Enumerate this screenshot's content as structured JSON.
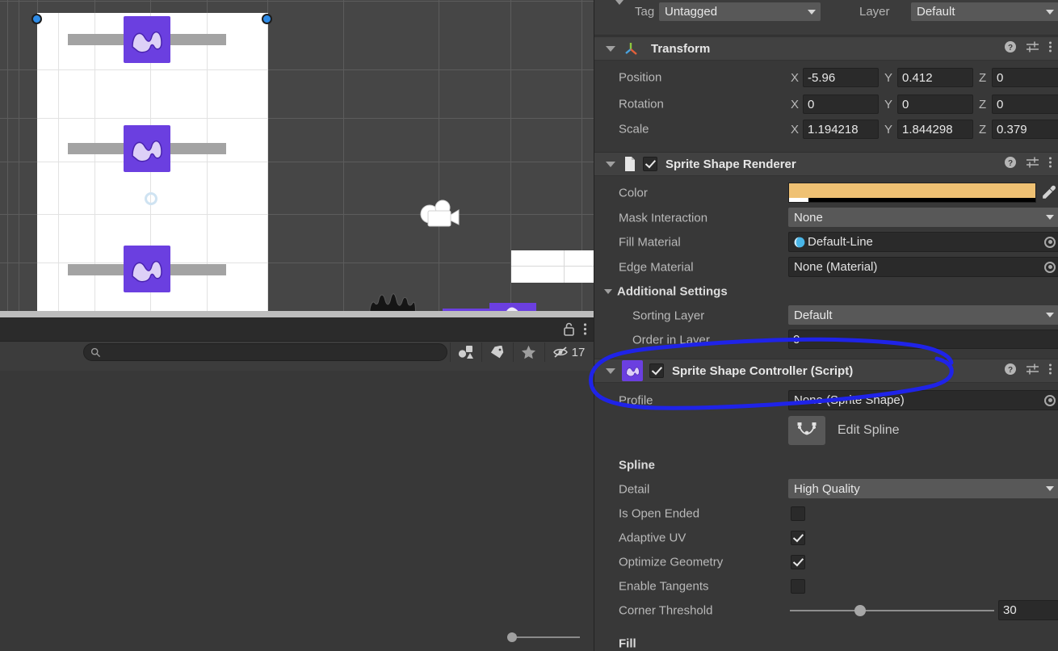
{
  "app": "unity-editor",
  "scene": {
    "name": "scene-view",
    "sprite_shape_label": "sprite-shape-selection",
    "gizmos": [
      "camera-gizmo",
      "spline-handle",
      "pivot-ring"
    ]
  },
  "hierarchy_toolbar": {
    "search_placeholder": "",
    "search_value": "",
    "icons": [
      "lock-icon",
      "kebab-menu-icon",
      "search-icon",
      "sprite-filter-icon",
      "tag-filter-icon",
      "favorite-star-icon",
      "hidden-objects-icon"
    ],
    "hidden_count": "17"
  },
  "inspector": {
    "tag": {
      "label": "Tag",
      "value": "Untagged"
    },
    "layer": {
      "label": "Layer",
      "value": "Default"
    },
    "transform": {
      "title": "Transform",
      "icon": "transform-axis-icon",
      "rows": [
        {
          "label": "Position",
          "x": "-5.96",
          "y": "0.412",
          "z": "0"
        },
        {
          "label": "Rotation",
          "x": "0",
          "y": "0",
          "z": "0"
        },
        {
          "label": "Scale",
          "x": "1.194218",
          "y": "1.844298",
          "z": "0.379"
        }
      ],
      "axis_x": "X",
      "axis_y": "Y",
      "axis_z": "Z"
    },
    "sprite_shape_renderer": {
      "title": "Sprite Shape Renderer",
      "enabled": true,
      "color": {
        "label": "Color",
        "value": "#efc173",
        "alpha_fraction": 0.08
      },
      "mask_interaction": {
        "label": "Mask Interaction",
        "value": "None"
      },
      "fill_material": {
        "label": "Fill Material",
        "value": "Default-Line"
      },
      "edge_material": {
        "label": "Edge Material",
        "value": "None (Material)"
      },
      "additional_settings": {
        "label": "Additional Settings",
        "sorting_layer": {
          "label": "Sorting Layer",
          "value": "Default"
        },
        "order_in_layer": {
          "label": "Order in Layer",
          "value": "0"
        }
      }
    },
    "sprite_shape_controller": {
      "title": "Sprite Shape Controller (Script)",
      "enabled": true,
      "icon": "sprite-shape-script-icon",
      "profile": {
        "label": "Profile",
        "value": "None (Sprite Shape)"
      },
      "edit_spline": {
        "label": "Edit Spline",
        "icon": "edit-spline-icon"
      },
      "spline_section": {
        "label": "Spline",
        "detail": {
          "label": "Detail",
          "value": "High Quality"
        },
        "is_open_ended": {
          "label": "Is Open Ended",
          "checked": false
        },
        "adaptive_uv": {
          "label": "Adaptive UV",
          "checked": true
        },
        "optimize_geometry": {
          "label": "Optimize Geometry",
          "checked": true
        },
        "enable_tangents": {
          "label": "Enable Tangents",
          "checked": false
        },
        "corner_threshold": {
          "label": "Corner Threshold",
          "value": "30",
          "fraction": 0.33
        }
      },
      "fill_section": {
        "label": "Fill"
      }
    },
    "header_icons": [
      "help-icon",
      "presets-icon",
      "kebab-menu-icon"
    ]
  },
  "annotation": {
    "name": "blue-circle-annotation",
    "color": "#1f23e8"
  }
}
